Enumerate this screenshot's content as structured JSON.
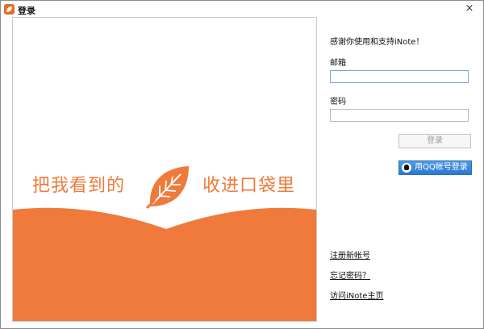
{
  "window": {
    "title": "登录",
    "close_symbol": "×"
  },
  "banner": {
    "slogan_left": "把我看到的",
    "slogan_right": "收进口袋里",
    "accent_color": "#ef7a3b",
    "icon": "leaf-icon"
  },
  "form": {
    "thanks_text": "感谢你使用和支持iNote！",
    "email_label": "邮箱",
    "email_value": "",
    "password_label": "密码",
    "password_value": "",
    "login_button": "登录",
    "qq_login_button": "用QQ帐号登录"
  },
  "links": {
    "register": "注册新帐号",
    "forgot_password": "忘记密码？",
    "visit_home": "访问iNote主页"
  }
}
